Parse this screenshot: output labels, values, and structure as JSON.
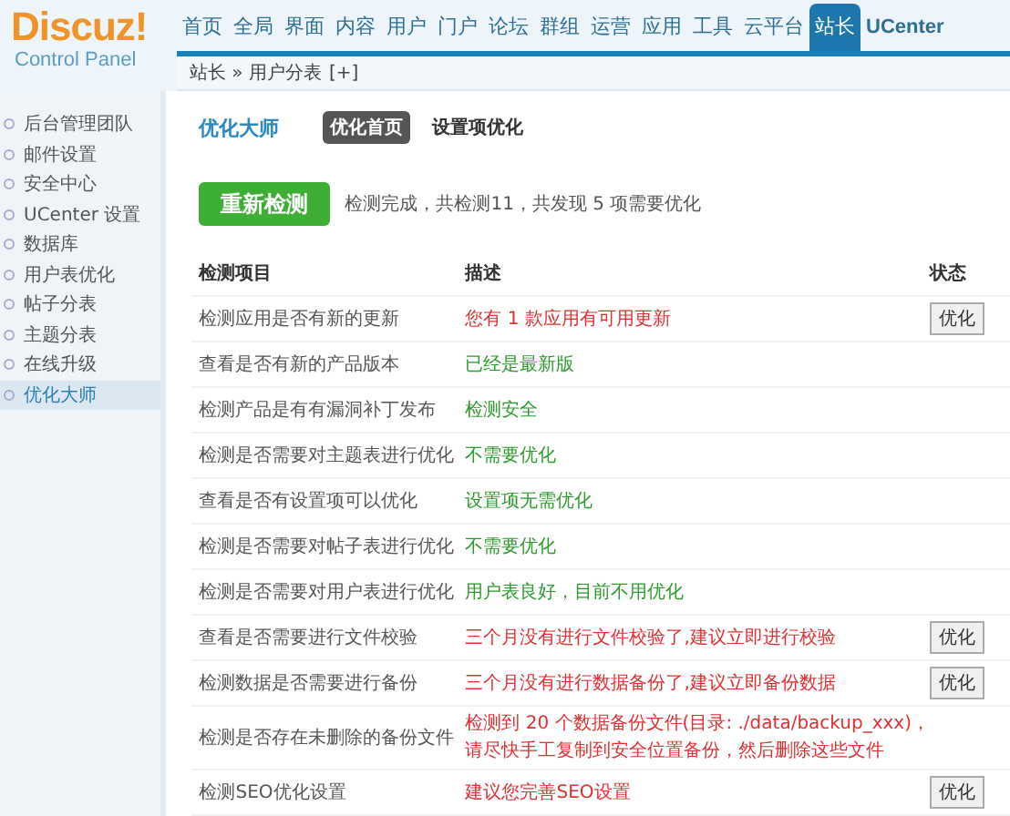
{
  "logo": {
    "brand": "Discuz!",
    "subtitle": "Control Panel"
  },
  "nav": [
    {
      "label": "首页",
      "selected": false
    },
    {
      "label": "全局",
      "selected": false
    },
    {
      "label": "界面",
      "selected": false
    },
    {
      "label": "内容",
      "selected": false
    },
    {
      "label": "用户",
      "selected": false
    },
    {
      "label": "门户",
      "selected": false
    },
    {
      "label": "论坛",
      "selected": false
    },
    {
      "label": "群组",
      "selected": false
    },
    {
      "label": "运营",
      "selected": false
    },
    {
      "label": "应用",
      "selected": false
    },
    {
      "label": "工具",
      "selected": false
    },
    {
      "label": "云平台",
      "selected": false
    },
    {
      "label": "站长",
      "selected": true
    },
    {
      "label": "UCenter",
      "selected": false
    }
  ],
  "breadcrumb": {
    "path": "站长 » 用户分表",
    "add": "[+]"
  },
  "sidebar": {
    "items": [
      {
        "label": "后台管理团队",
        "selected": false
      },
      {
        "label": "邮件设置",
        "selected": false
      },
      {
        "label": "安全中心",
        "selected": false
      },
      {
        "label": "UCenter 设置",
        "selected": false
      },
      {
        "label": "数据库",
        "selected": false
      },
      {
        "label": "用户表优化",
        "selected": false
      },
      {
        "label": "帖子分表",
        "selected": false
      },
      {
        "label": "主题分表",
        "selected": false
      },
      {
        "label": "在线升级",
        "selected": false
      },
      {
        "label": "优化大师",
        "selected": true
      }
    ]
  },
  "main": {
    "title": "优化大师",
    "subtabs": [
      {
        "label": "优化首页",
        "selected": true
      },
      {
        "label": "设置项优化",
        "selected": false
      }
    ],
    "recheck_button": "重新检测",
    "summary": "检测完成，共检测11，共发现 5 项需要优化",
    "table": {
      "columns": [
        "检测项目",
        "描述",
        "状态"
      ],
      "rows": [
        {
          "item": "检测应用是否有新的更新",
          "description": [
            "您有 1 款应用有可用更新"
          ],
          "color": "#e03030",
          "action": "优化"
        },
        {
          "item": "查看是否有新的产品版本",
          "description": [
            "已经是最新版"
          ],
          "color": "#2d9a2d"
        },
        {
          "item": "检测产品是有有漏洞补丁发布",
          "description": [
            "检测安全"
          ],
          "color": "#2d9a2d"
        },
        {
          "item": "检测是否需要对主题表进行优化",
          "description": [
            "不需要优化"
          ],
          "color": "#2d9a2d"
        },
        {
          "item": "查看是否有设置项可以优化",
          "description": [
            "设置项无需优化"
          ],
          "color": "#2d9a2d"
        },
        {
          "item": "检测是否需要对帖子表进行优化",
          "description": [
            "不需要优化"
          ],
          "color": "#2d9a2d"
        },
        {
          "item": "检测是否需要对用户表进行优化",
          "description": [
            "用户表良好，目前不用优化"
          ],
          "color": "#2d9a2d"
        },
        {
          "item": "查看是否需要进行文件校验",
          "description": [
            "三个月没有进行文件校验了,建议立即进行校验"
          ],
          "color": "#e03030",
          "action": "优化"
        },
        {
          "item": "检测数据是否需要进行备份",
          "description": [
            "三个月没有进行数据备份了,建议立即备份数据"
          ],
          "color": "#e03030",
          "action": "优化"
        },
        {
          "item": "检测是否存在未删除的备份文件",
          "description": [
            "检测到 20 个数据备份文件(目录: ./data/backup_xxx)，",
            "请尽快手工复制到安全位置备份，然后删除这些文件"
          ],
          "color": "#e03030"
        },
        {
          "item": "检测SEO优化设置",
          "description": [
            "建议您完善SEO设置"
          ],
          "color": "#e03030",
          "action": "优化"
        }
      ]
    }
  }
}
